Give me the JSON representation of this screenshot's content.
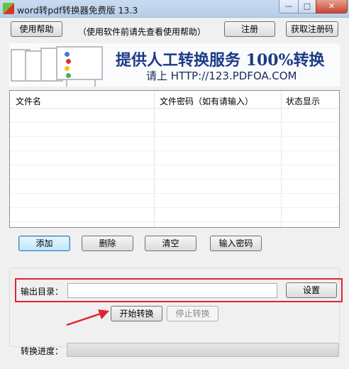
{
  "window": {
    "title": "word转pdf转换器免费版 13.3",
    "min_symbol": "—",
    "max_symbol": "□",
    "close_symbol": "✕"
  },
  "toolbar": {
    "help_label": "使用帮助",
    "help_note": "（使用软件前请先查看使用帮助）",
    "register_label": "注册",
    "get_code_label": "获取注册码"
  },
  "banner": {
    "headline": "提供人工转换服务 100%转换",
    "subline": "请上  HTTP://123.PDFOA.COM"
  },
  "file_list": {
    "columns": [
      "文件名",
      "文件密码（如有请输入）",
      "状态显示"
    ],
    "rows": []
  },
  "actions": {
    "add_label": "添加",
    "delete_label": "删除",
    "clear_label": "清空",
    "password_label": "输入密码"
  },
  "output": {
    "dir_label": "输出目录：",
    "dir_value": "",
    "settings_label": "设置",
    "start_label": "开始转换",
    "stop_label": "停止转换"
  },
  "progress": {
    "label": "转换进度：",
    "value": 0
  },
  "colors": {
    "highlight": "#e0262d",
    "banner_text": "#1c3a86"
  }
}
